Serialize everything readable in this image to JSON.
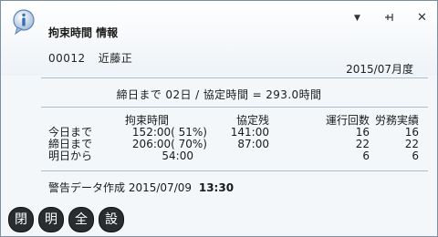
{
  "window": {
    "title": "拘束時間 情報",
    "controls": {
      "menu": "▼",
      "pin": "ꟷ",
      "close": "✕"
    }
  },
  "employee": {
    "id": "00012",
    "name": "近藤正"
  },
  "period": "2015/07月度",
  "summary": "締日まで 02日 / 協定時間 = 293.0時間",
  "table": {
    "headers": [
      "",
      "拘束時間",
      "協定残",
      "運行回数",
      "労務実績"
    ],
    "rows": [
      [
        "今日まで",
        "152:00( 51%)",
        "141:00",
        "16",
        "16"
      ],
      [
        "締日まで",
        "206:00( 70%)",
        "87:00",
        "22",
        "22"
      ],
      [
        "明日から",
        "54:00",
        "",
        "6",
        "6"
      ]
    ]
  },
  "warning": {
    "label": "警告データ作成",
    "date": "2015/07/09",
    "time": "13:30"
  },
  "buttons": [
    "閉",
    "明",
    "全",
    "設"
  ],
  "colors": {
    "button_bg": "#2a2d30",
    "divider": "#aebccb",
    "icon_accent": "#3a6fb0"
  }
}
